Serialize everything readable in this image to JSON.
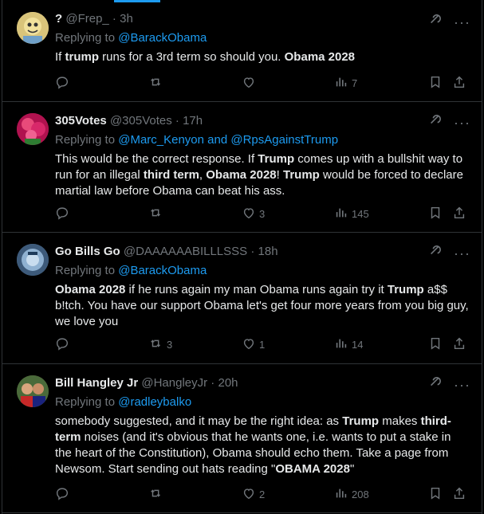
{
  "tweets": [
    {
      "name": "?",
      "handle": "@Frep_",
      "time": "3h",
      "replying_label": "Replying to ",
      "replying_to": "@BarackObama",
      "body_parts": [
        {
          "t": "If ",
          "b": false
        },
        {
          "t": "trump",
          "b": true
        },
        {
          "t": " runs for a 3rd term so should you. ",
          "b": false
        },
        {
          "t": "Obama 2028",
          "b": true
        }
      ],
      "replies": "",
      "retweets": "",
      "likes": "",
      "views": "7"
    },
    {
      "name": "305Votes",
      "handle": "@305Votes",
      "time": "17h",
      "replying_label": "Replying to ",
      "replying_to": "@Marc_Kenyon and @RpsAgainstTrump",
      "body_parts": [
        {
          "t": "This would be the correct response. If ",
          "b": false
        },
        {
          "t": "Trump",
          "b": true
        },
        {
          "t": " comes up with a bullshit way to run for an illegal ",
          "b": false
        },
        {
          "t": "third term",
          "b": true
        },
        {
          "t": ", ",
          "b": false
        },
        {
          "t": "Obama 2028",
          "b": true
        },
        {
          "t": "! ",
          "b": false
        },
        {
          "t": "Trump",
          "b": true
        },
        {
          "t": " would be forced to declare martial law before Obama can beat his ass.",
          "b": false
        }
      ],
      "replies": "",
      "retweets": "",
      "likes": "3",
      "views": "145"
    },
    {
      "name": "Go Bills Go",
      "handle": "@DAAAAAABILLLSSS",
      "time": "18h",
      "replying_label": "Replying to ",
      "replying_to": "@BarackObama",
      "body_parts": [
        {
          "t": "Obama 2028",
          "b": true
        },
        {
          "t": " if he runs again my man Obama runs again try it ",
          "b": false
        },
        {
          "t": "Trump",
          "b": true
        },
        {
          "t": " a$$ b!tch. You have our support Obama let's get four more years from you big guy, we love you",
          "b": false
        }
      ],
      "replies": "",
      "retweets": "3",
      "likes": "1",
      "views": "14"
    },
    {
      "name": "Bill Hangley Jr",
      "handle": "@HangleyJr",
      "time": "20h",
      "replying_label": "Replying to ",
      "replying_to": "@radleybalko",
      "body_parts": [
        {
          "t": "somebody suggested, and it may be the right idea: as ",
          "b": false
        },
        {
          "t": "Trump",
          "b": true
        },
        {
          "t": " makes ",
          "b": false
        },
        {
          "t": "third-term",
          "b": true
        },
        {
          "t": " noises (and it's obvious that he wants one, i.e. wants to put a stake in the heart of the Constitution), Obama should echo them. Take a page from Newsom. Start sending out hats reading \"",
          "b": false
        },
        {
          "t": "OBAMA 2028",
          "b": true
        },
        {
          "t": "\"",
          "b": false
        }
      ],
      "replies": "",
      "retweets": "",
      "likes": "2",
      "views": "208"
    }
  ],
  "icons": {
    "reply": "reply-icon",
    "retweet": "retweet-icon",
    "like": "like-icon",
    "views": "views-icon",
    "bookmark": "bookmark-icon",
    "share": "share-icon",
    "grok": "grok-icon",
    "more": "more-icon"
  },
  "colors": {
    "background": "#000000",
    "text": "#e7e9ea",
    "muted": "#71767b",
    "link": "#1d9bf0",
    "border": "#2f3336"
  }
}
